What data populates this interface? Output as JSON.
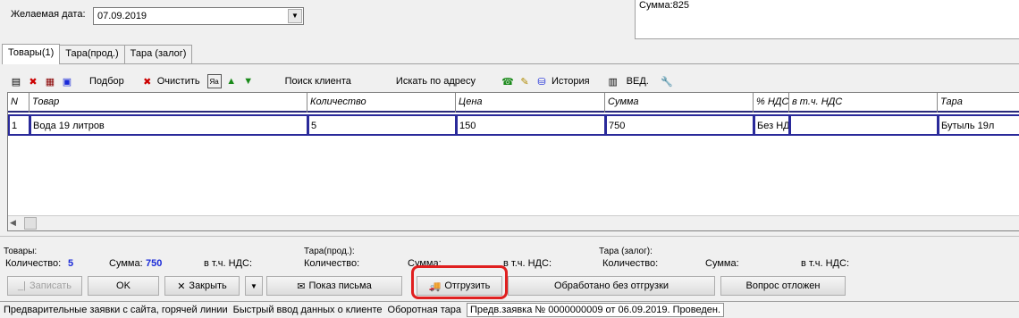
{
  "header": {
    "date_label": "Желаемая дата:",
    "date_value": "07.09.2019",
    "info_line": "Сумма:825"
  },
  "tabs": [
    {
      "label": "Товары(1)",
      "active": true
    },
    {
      "label": "Тара(прод.)",
      "active": false
    },
    {
      "label": "Тара (залог)",
      "active": false
    }
  ],
  "toolbar": {
    "podbor": "Подбор",
    "clear": "Очистить",
    "search_client": "Поиск клиента",
    "search_address": "Искать по адресу",
    "history": "История",
    "ved": "ВЕД."
  },
  "table": {
    "columns": [
      "N",
      "Товар",
      "Количество",
      "Цена",
      "Сумма",
      "% НДС",
      "в т.ч. НДС",
      "Тара"
    ],
    "rows": [
      [
        "1",
        "Вода 19 литров",
        "5",
        "150",
        "750",
        "Без НДС",
        "",
        "Бутыль 19л"
      ]
    ]
  },
  "summary": {
    "goods": {
      "title": "Товары:",
      "qty_label": "Количество:",
      "qty": "5",
      "sum_label": "Сумма:",
      "sum": "750",
      "vat_label": "в т.ч. НДС:"
    },
    "tara_prod": {
      "title": "Тара(прод.):",
      "qty_label": "Количество:",
      "sum_label": "Сумма:",
      "vat_label": "в т.ч. НДС:"
    },
    "tara_zalog": {
      "title": "Тара (залог):",
      "qty_label": "Количество:",
      "sum_label": "Сумма:",
      "vat_label": "в т.ч. НДС:"
    }
  },
  "buttons": {
    "save": "Записать",
    "ok": "OK",
    "close": "Закрыть",
    "show_letter": "Показ письма",
    "ship": "Отгрузить",
    "processed_no_ship": "Обработано без отгрузки",
    "postponed": "Вопрос отложен"
  },
  "status_tabs": [
    "Предварительные заявки с сайта, горячей линии",
    "Быстрый ввод данных о клиенте",
    "Оборотная тара",
    "Предв.заявка № 0000000009 от 06.09.2019. Проведен."
  ],
  "colors": {
    "accent_blue": "#1a2ad8",
    "highlight_red": "#e02020",
    "grid_border": "#2a2a9a"
  }
}
